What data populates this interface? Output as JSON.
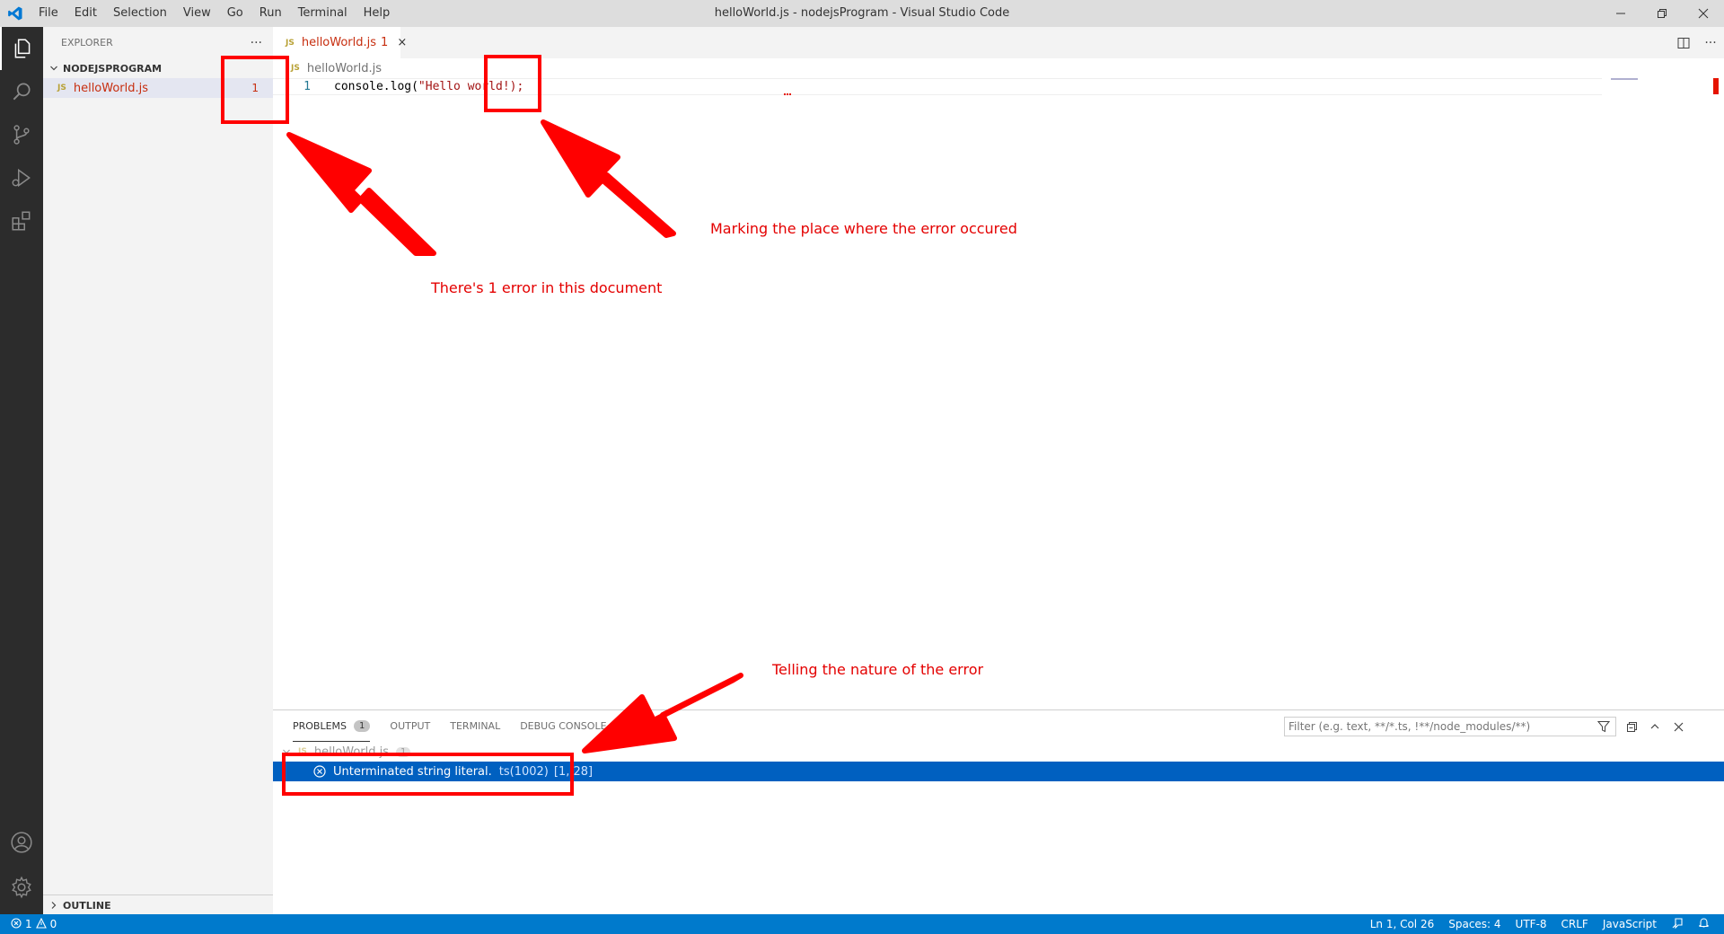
{
  "titlebar": {
    "menu": [
      "File",
      "Edit",
      "Selection",
      "View",
      "Go",
      "Run",
      "Terminal",
      "Help"
    ],
    "title": "helloWorld.js - nodejsProgram - Visual Studio Code"
  },
  "activity_bar": {
    "items": [
      "explorer-icon",
      "search-icon",
      "source-control-icon",
      "run-debug-icon",
      "extensions-icon",
      "accounts-icon",
      "manage-gear-icon"
    ]
  },
  "sidebar": {
    "header": "EXPLORER",
    "more": "···",
    "section": "NODEJSPROGRAM",
    "file": {
      "badge": "JS",
      "name": "helloWorld.js",
      "errors": "1"
    },
    "outline": "OUTLINE"
  },
  "editor": {
    "tab": {
      "badge": "JS",
      "name": "helloWorld.js",
      "count": "1",
      "close": "×"
    },
    "breadcrumb": {
      "badge": "JS",
      "name": "helloWorld.js"
    },
    "line_number": "1",
    "code": {
      "fn": "console.log(",
      "str": "\"Hello world!);"
    }
  },
  "panel": {
    "tabs": [
      {
        "label": "PROBLEMS",
        "count": "1"
      },
      {
        "label": "OUTPUT"
      },
      {
        "label": "TERMINAL"
      },
      {
        "label": "DEBUG CONSOLE"
      }
    ],
    "filter_placeholder": "Filter (e.g. text, **/*.ts, !**/node_modules/**)",
    "group": {
      "badge": "JS",
      "name": "helloWorld.js",
      "count": "1"
    },
    "problem": {
      "message": "Unterminated string literal.",
      "source": "ts(1002)",
      "position": "[1, 28]"
    }
  },
  "statusbar": {
    "errors": "1",
    "warnings": "0",
    "position": "Ln 1, Col 26",
    "spaces": "Spaces: 4",
    "encoding": "UTF-8",
    "eol": "CRLF",
    "language": "JavaScript"
  },
  "annotations": {
    "file_error": "There's 1 error in this document",
    "error_location": "Marking the place where the error occured",
    "error_nature": "Telling the nature of the error"
  },
  "colors": {
    "annotation_red": "#ff0000",
    "error_red": "#c72e0f",
    "status_blue": "#007acc",
    "selection_blue": "#0060c0"
  }
}
